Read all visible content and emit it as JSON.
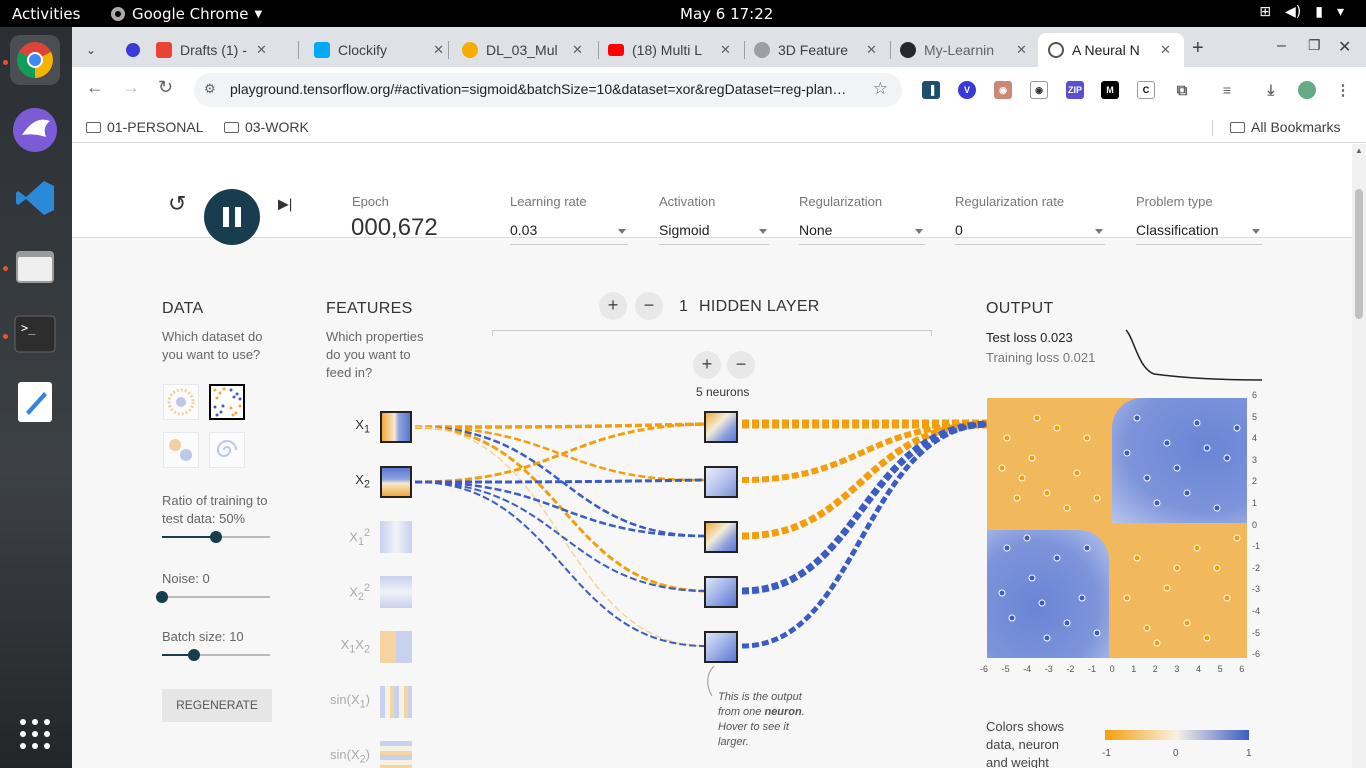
{
  "system_bar": {
    "activities": "Activities",
    "app_name": "Google Chrome",
    "clock": "May 6  17:22"
  },
  "dock": {
    "items": [
      "chrome-icon",
      "bird-browser-icon",
      "vscode-icon",
      "files-icon",
      "terminal-icon",
      "text-editor-icon",
      "app-grid-icon"
    ]
  },
  "tabs": [
    {
      "title": "",
      "icon": "tab-list-icon"
    },
    {
      "title": "Drafts (1) -",
      "icon": "gmail-icon",
      "color": "#ea4335"
    },
    {
      "title": "Clockify",
      "icon": "clockify-icon",
      "color": "#03a9f4"
    },
    {
      "title": "DL_03_Mul",
      "icon": "colab-icon",
      "color": "#f9ab00"
    },
    {
      "title": "(18) Multi L",
      "icon": "youtube-icon",
      "color": "#ff0000"
    },
    {
      "title": "3D Feature",
      "icon": "web-icon",
      "color": "#5f6368"
    },
    {
      "title": "My-Learnin",
      "icon": "github-icon",
      "color": "#24292e"
    },
    {
      "title": "A Neural N",
      "icon": "tensorflow-icon",
      "color": "#ff6f00",
      "active": true
    }
  ],
  "toolbar": {
    "url": "playground.tensorflow.org/#activation=sigmoid&batchSize=10&dataset=xor&regDataset=reg-plan…"
  },
  "bookmarks": {
    "items": [
      "01-PERSONAL",
      "03-WORK"
    ],
    "all": "All Bookmarks"
  },
  "controls": {
    "epoch_label": "Epoch",
    "epoch_value": "000,672",
    "learning_rate_label": "Learning rate",
    "learning_rate_value": "0.03",
    "activation_label": "Activation",
    "activation_value": "Sigmoid",
    "regularization_label": "Regularization",
    "regularization_value": "None",
    "reg_rate_label": "Regularization rate",
    "reg_rate_value": "0",
    "problem_type_label": "Problem type",
    "problem_type_value": "Classification"
  },
  "data_panel": {
    "title": "DATA",
    "question": "Which dataset do you want to use?",
    "ratio_label": "Ratio of training to test data:  50%",
    "ratio": 0.5,
    "noise_label": "Noise:  0",
    "noise": 0,
    "batch_label": "Batch size:  10",
    "batch": 0.3,
    "regenerate": "REGENERATE"
  },
  "features_panel": {
    "title": "FEATURES",
    "question": "Which properties do you want to feed in?"
  },
  "hidden": {
    "count": "1",
    "label": "HIDDEN LAYER",
    "neurons_label": "5 neurons",
    "callout_1": "This is the output from one ",
    "callout_bold": "neuron",
    "callout_2": ". Hover to see it larger."
  },
  "output": {
    "title": "OUTPUT",
    "test_loss": "Test loss 0.023",
    "training_loss": "Training loss 0.021",
    "y_ticks": [
      "6",
      "5",
      "4",
      "3",
      "2",
      "1",
      "0",
      "-1",
      "-2",
      "-3",
      "-4",
      "-5",
      "-6"
    ],
    "x_ticks": [
      "-6",
      "-5",
      "-4",
      "-3",
      "-2",
      "-1",
      "0",
      "1",
      "2",
      "3",
      "4",
      "5",
      "6"
    ],
    "legend_text": "Colors shows data, neuron and weight values.",
    "legend_ticks": [
      "-1",
      "0",
      "1"
    ]
  },
  "colors": {
    "orange": "#f59e0b",
    "blue": "#3b5cc4",
    "dark": "#183d4e"
  }
}
